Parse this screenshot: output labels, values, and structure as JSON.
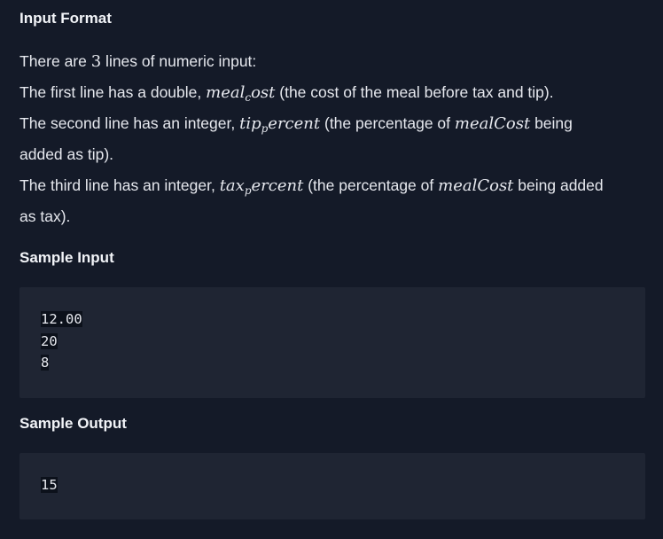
{
  "input_format": {
    "heading": "Input Format",
    "line1_pre": "There are ",
    "line1_num": "3",
    "line1_post": " lines of numeric input:",
    "line2_pre": "The first line has a double, ",
    "line2_var_a": "meal",
    "line2_var_sub": "c",
    "line2_var_b": "ost",
    "line2_post": " (the cost of the meal before tax and tip).",
    "line3_pre": "The second line has an integer, ",
    "line3_var_a": "tip",
    "line3_var_sub": "p",
    "line3_var_b": "ercent",
    "line3_mid": " (the percentage of ",
    "line3_var2": "mealCost",
    "line3_post": " being",
    "line4": "added as tip).",
    "line5_pre": "The third line has an integer, ",
    "line5_var_a": "tax",
    "line5_var_sub": "p",
    "line5_var_b": "ercent",
    "line5_mid": " (the percentage of ",
    "line5_var2": "mealCost",
    "line5_post": " being added",
    "line6": "as tax)."
  },
  "sample_input": {
    "heading": "Sample Input",
    "lines": [
      "12.00",
      "20",
      "8"
    ]
  },
  "sample_output": {
    "heading": "Sample Output",
    "lines": [
      "15"
    ]
  }
}
